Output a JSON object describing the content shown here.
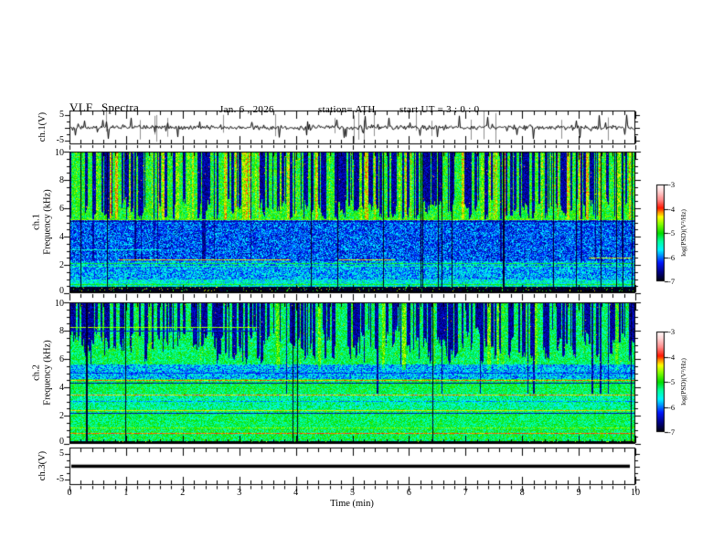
{
  "header": {
    "title": "VLF Spectra",
    "date": "Jan. 6 , 2026",
    "station": "station= ATH",
    "start_ut": "start UT =  3 : 0 : 0"
  },
  "axes": {
    "time_label": "Time (min)",
    "time_ticks": [
      "0",
      "1",
      "2",
      "3",
      "4",
      "5",
      "6",
      "7",
      "8",
      "9",
      "10"
    ],
    "freq_ticks": [
      "10",
      "8",
      "6",
      "4",
      "2",
      "0"
    ],
    "volt_ticks": [
      "5",
      "-5"
    ],
    "ch1_wave_label": "ch.1(V)",
    "ch3_wave_label": "ch.3(V)",
    "spec1_label_line1": "ch.1",
    "spec1_label_line2": "Frequency (kHz)",
    "spec2_label_line1": "ch.2",
    "spec2_label_line2": "Frequency (kHz)",
    "colorbar_label": "log(PSD)(V²/Hz)",
    "colorbar_ticks": [
      "-3",
      "-4",
      "-5",
      "-6",
      "-7"
    ]
  },
  "colormap": {
    "stops": [
      [
        0,
        "#000000"
      ],
      [
        0.1,
        "#000085"
      ],
      [
        0.2,
        "#0018FF"
      ],
      [
        0.33,
        "#00F5FF"
      ],
      [
        0.42,
        "#00FF9A"
      ],
      [
        0.5,
        "#00DC00"
      ],
      [
        0.6,
        "#8CFF00"
      ],
      [
        0.67,
        "#FFFF00"
      ],
      [
        0.72,
        "#FF8A00"
      ],
      [
        0.76,
        "#FF1500"
      ],
      [
        0.85,
        "#FF8C8C"
      ],
      [
        0.94,
        "#FFD9D9"
      ],
      [
        1,
        "#FFF7F7"
      ]
    ]
  },
  "chart_data": [
    {
      "id": "ch1-waveform",
      "type": "line",
      "ylabel": "ch.1(V)",
      "ylim": [
        -5,
        5
      ],
      "xlim": [
        0,
        10
      ],
      "description": "Broadband noise waveform centered on 0 V, typical excursion ±1 V with dense impulsive spikes to ±5 V and occasional gray clipped spikes",
      "gen": {
        "noise_sigma": 0.45,
        "spike_prob": 0.1,
        "spike_max": 4.8,
        "gray_spike_prob": 0.035
      }
    },
    {
      "id": "ch1-spectrogram",
      "type": "heatmap",
      "ylabel_line1": "ch.1",
      "ylabel_line2": "Frequency (kHz)",
      "xlim": [
        0,
        10
      ],
      "ylim": [
        0,
        10
      ],
      "zlim": [
        -7,
        -3
      ],
      "zlabel": "log(PSD)(V²/Hz)",
      "description": "Green/yellow band 5.2–10 kHz with red speckles and dark vertical sferic streaks; blue band 2.2–5.2 kHz; cyan/blue below 2.2 kHz; black band below 0.4 kHz; red-brown horizontal segments near 2.3 kHz",
      "bands": [
        {
          "f": [
            5.2,
            10
          ],
          "base": -5.0,
          "noise": 0.45
        },
        {
          "f": [
            2.2,
            5.2
          ],
          "base": -6.1,
          "noise": 0.5
        },
        {
          "f": [
            0.9,
            2.2
          ],
          "base": -5.85,
          "noise": 0.5
        },
        {
          "f": [
            0.38,
            0.9
          ],
          "base": -5.55,
          "noise": 0.45
        },
        {
          "f": [
            0,
            0.38
          ],
          "base": -6.9,
          "noise": 0.12
        }
      ],
      "lines": [
        {
          "f": 5.2,
          "v": -4.7,
          "x": [
            0,
            10
          ]
        },
        {
          "f": 5.05,
          "v": -6.5,
          "x": [
            0,
            10
          ]
        },
        {
          "f": 2.05,
          "v": -5.05,
          "x": [
            0,
            10
          ]
        },
        {
          "f": 1.85,
          "v": -5.3,
          "x": [
            0,
            10
          ]
        },
        {
          "f": 0.55,
          "v": -4.95,
          "x": [
            0,
            10
          ]
        },
        {
          "f": 2.3,
          "v": -4.3,
          "x": [
            0.85,
            3.9
          ]
        },
        {
          "f": 2.3,
          "v": -4.3,
          "x": [
            4.75,
            5.75
          ]
        },
        {
          "f": 2.42,
          "v": -4.35,
          "x": [
            9.2,
            9.95
          ]
        },
        {
          "f": 3.05,
          "v": -5.5,
          "x": [
            0,
            1.6
          ]
        }
      ],
      "streaks": {
        "dark_prob": 0.3,
        "dark_f_end": [
          5.2,
          6.6
        ],
        "bright_prob": 0.1,
        "bright_amp": [
          0.2,
          0.7
        ],
        "deep_prob": 0.035,
        "deep_f_end": 2.2,
        "black_prob": 0.025,
        "speckle_prob": 0.006,
        "speckle_v": -4.05,
        "bottom_speckle_prob": 0.07,
        "bottom_f": 0.38
      }
    },
    {
      "id": "ch2-spectrogram",
      "type": "heatmap",
      "ylabel_line1": "ch.2",
      "ylabel_line2": "Frequency (kHz)",
      "xlim": [
        0,
        10
      ],
      "ylim": [
        0,
        10
      ],
      "zlim": [
        -7,
        -3
      ],
      "zlabel": "log(PSD)(V²/Hz)",
      "description": "Green/cyan background with dark blue wedge streaks above 5.8 kHz; red/orange horizontal lines near 4.45, 3.4, 2.3 and 0.65 kHz; thin black bottom edge",
      "bands": [
        {
          "f": [
            5.6,
            10
          ],
          "base": -5.2,
          "noise": 0.4
        },
        {
          "f": [
            4.55,
            5.6
          ],
          "base": -5.8,
          "noise": 0.5
        },
        {
          "f": [
            3.5,
            4.55
          ],
          "base": -5.15,
          "noise": 0.4
        },
        {
          "f": [
            2.4,
            3.5
          ],
          "base": -5.35,
          "noise": 0.45
        },
        {
          "f": [
            1.05,
            2.4
          ],
          "base": -5.2,
          "noise": 0.4
        },
        {
          "f": [
            0.12,
            1.05
          ],
          "base": -5.15,
          "noise": 0.4
        },
        {
          "f": [
            0,
            0.12
          ],
          "base": -6.95,
          "noise": 0.1
        }
      ],
      "lines": [
        {
          "f": 4.45,
          "v": -4.15,
          "x": [
            0,
            10
          ]
        },
        {
          "f": 4.28,
          "v": -6.5,
          "x": [
            0,
            10
          ]
        },
        {
          "f": 3.42,
          "v": -4.2,
          "x": [
            0,
            10
          ]
        },
        {
          "f": 2.95,
          "v": -5.9,
          "x": [
            0,
            10
          ]
        },
        {
          "f": 2.28,
          "v": -4.35,
          "x": [
            0,
            10
          ]
        },
        {
          "f": 2.12,
          "v": -6.4,
          "x": [
            0,
            10
          ]
        },
        {
          "f": 1.02,
          "v": -4.7,
          "x": [
            0,
            10
          ]
        },
        {
          "f": 0.65,
          "v": -4.05,
          "x": [
            0,
            10
          ]
        },
        {
          "f": 8.3,
          "v": -4.6,
          "x": [
            0,
            3.3
          ]
        },
        {
          "f": 8.05,
          "v": -6.3,
          "x": [
            0,
            3.3
          ]
        },
        {
          "f": 5.0,
          "v": -6.2,
          "x": [
            0,
            10
          ]
        }
      ],
      "streaks": {
        "dark_prob": 0.34,
        "dark_f_end": [
          5.8,
          8.2
        ],
        "bright_prob": 0.05,
        "bright_amp": [
          0.15,
          0.5
        ],
        "deep_prob": 0.02,
        "deep_f_end": 3.5,
        "black_prob": 0.012,
        "speckle_prob": 0.004,
        "speckle_v": -4.1,
        "bottom_speckle_prob": 0.05,
        "bottom_f": 0.12
      }
    },
    {
      "id": "ch3-waveform",
      "type": "line",
      "ylabel": "ch.3(V)",
      "ylim": [
        -5,
        5
      ],
      "xlim": [
        0,
        10
      ],
      "description": "Flat thick black trace at 0 V (channel idle)",
      "value": 0,
      "thickness_px": 3.5
    }
  ]
}
